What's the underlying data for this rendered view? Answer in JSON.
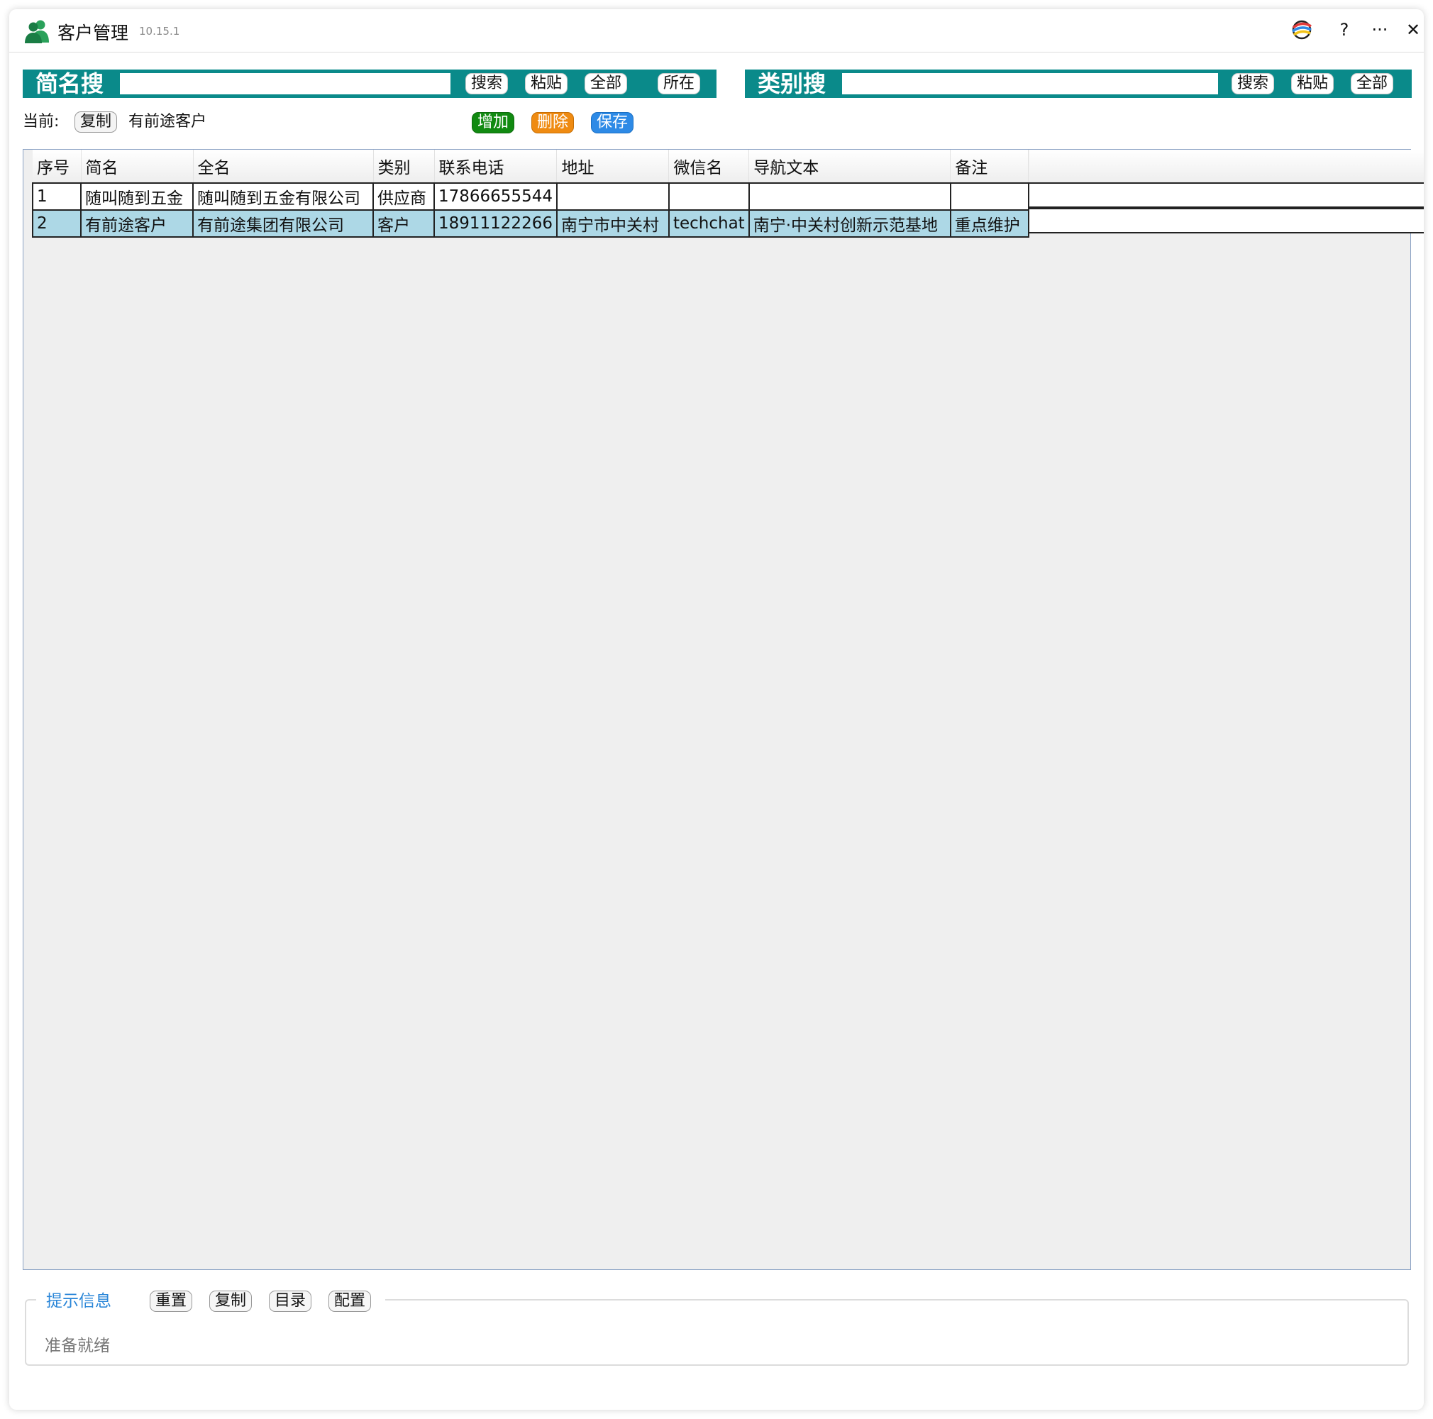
{
  "window": {
    "title": "客户管理",
    "version": "10.15.1",
    "help_label": "?",
    "more_label": "···",
    "close_label": "✕"
  },
  "colors": {
    "header_bar": "#0a8a8a",
    "add": "#118a11",
    "delete": "#ef8b12",
    "save": "#2d8ae6",
    "selected_row": "#add8e6",
    "legend_text": "#2a86d8"
  },
  "short_search": {
    "label": "简名搜",
    "input_value": "",
    "search_btn": "搜索",
    "paste_btn": "粘贴",
    "all_btn": "全部",
    "locate_btn": "所在"
  },
  "category_search": {
    "label": "类别搜",
    "input_value": "",
    "search_btn": "搜索",
    "paste_btn": "粘贴",
    "all_btn": "全部"
  },
  "current": {
    "label": "当前:",
    "copy_btn": "复制",
    "value": "有前途客户",
    "add_btn": "增加",
    "delete_btn": "删除",
    "save_btn": "保存"
  },
  "table": {
    "columns": [
      "序号",
      "简名",
      "全名",
      "类别",
      "联系电话",
      "地址",
      "微信名",
      "导航文本",
      "备注"
    ],
    "rows": [
      [
        "1",
        "随叫随到五金",
        "随叫随到五金有限公司",
        "供应商",
        "17866655544",
        "",
        "",
        "",
        ""
      ],
      [
        "2",
        "有前途客户",
        "有前途集团有限公司",
        "客户",
        "18911122266",
        "南宁市中关村",
        "techchat",
        "南宁·中关村创新示范基地",
        "重点维护"
      ]
    ],
    "selected_row": 2
  },
  "status": {
    "legend": "提示信息",
    "reset_btn": "重置",
    "copy_btn": "复制",
    "dir_btn": "目录",
    "config_btn": "配置",
    "message": "准备就绪"
  }
}
